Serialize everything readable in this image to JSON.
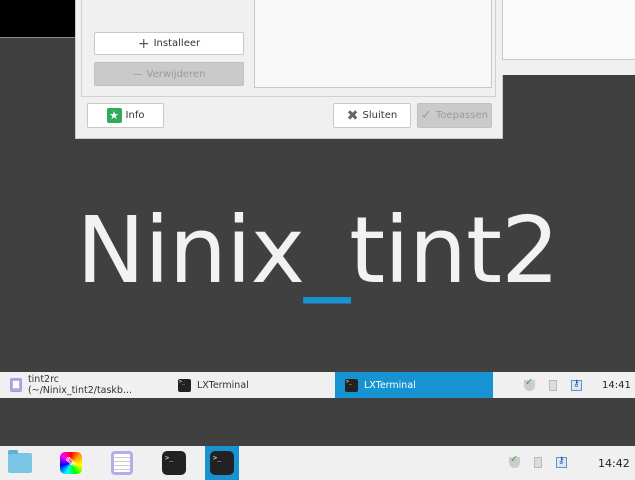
{
  "dialog": {
    "install_label": "Installeer",
    "remove_label": "Verwijderen",
    "info_label": "Info",
    "close_label": "Sluiten",
    "apply_label": "Toepassen"
  },
  "desktop": {
    "brand_left": "Ninix",
    "brand_sep": "_",
    "brand_right": "tint2"
  },
  "taskbar_top": {
    "tasks": [
      {
        "label": "tint2rc (~/Ninix_tint2/taskb...",
        "icon": "text-editor-icon"
      },
      {
        "label": "LXTerminal",
        "icon": "terminal-icon"
      },
      {
        "label": "LXTerminal",
        "icon": "terminal-icon",
        "active": true
      }
    ],
    "clock": "14:41"
  },
  "panel_bottom": {
    "launchers": [
      "file-manager-icon",
      "paint-icon",
      "text-editor-icon",
      "terminal-icon",
      "terminal-icon"
    ],
    "clock": "14:42"
  },
  "colors": {
    "accent": "#1793d1",
    "desktop": "#404040",
    "panel": "#f0f0f0"
  }
}
